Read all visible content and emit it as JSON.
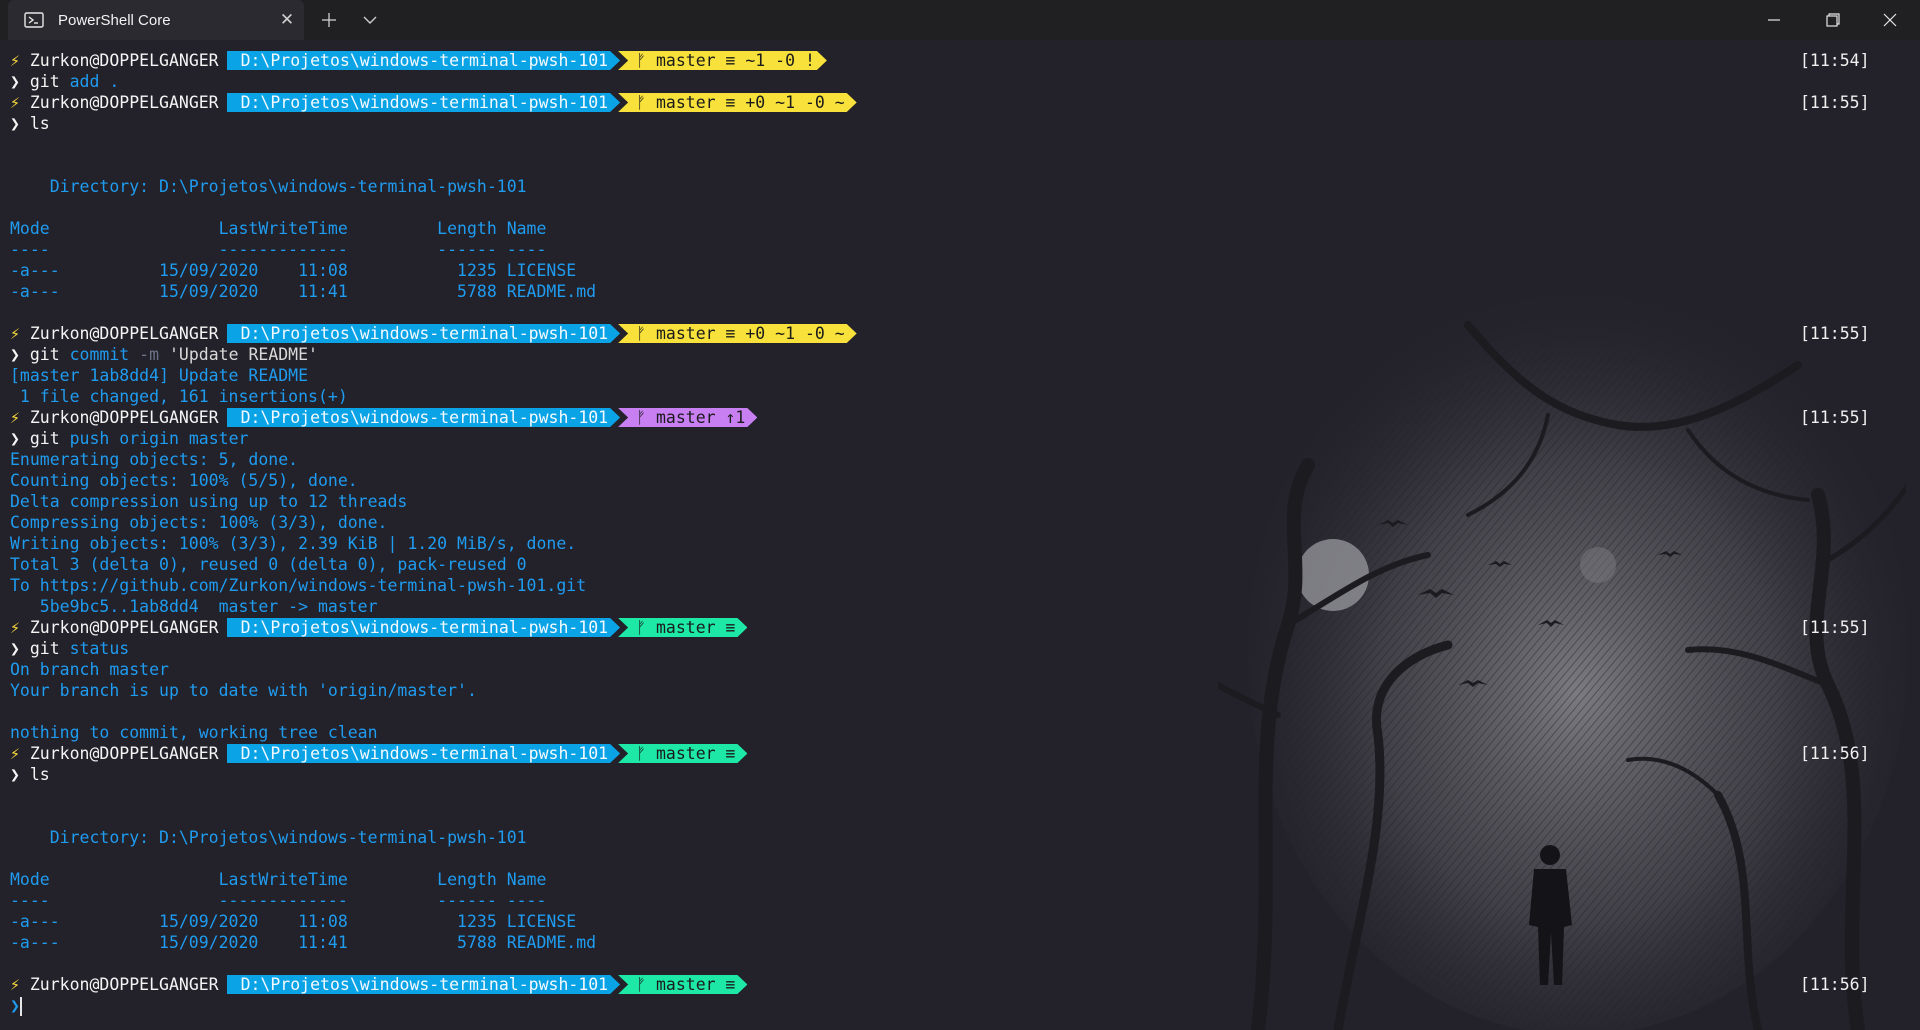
{
  "window": {
    "tab_title": "PowerShell Core",
    "tab_icon": "powershell-icon",
    "new_tab_icon": "plus-icon",
    "dropdown_icon": "chevron-down-icon",
    "minimize_icon": "minimize-icon",
    "maximize_icon": "restore-icon",
    "close_icon": "close-icon"
  },
  "colors": {
    "background": "#232129",
    "path_segment": "#0aa3e6",
    "git_dirty": "#f7e13a",
    "git_ahead": "#c77ff2",
    "git_clean": "#1ee8a6",
    "output": "#1f9cf0"
  },
  "prompt": {
    "symbol": "⚡",
    "user": "Zurkon@DOPPELGANGER",
    "path": "D:\\Projetos\\windows-terminal-pwsh-101",
    "branch_icon": "ᚠ",
    "input_symbol": "❯"
  },
  "lines": [
    {
      "kind": "prompt",
      "git": "master ≡ ~1 -0 !",
      "git_color": "#f7e13a",
      "time": "[11:54]"
    },
    {
      "kind": "cmd",
      "cmd": "git",
      "args": "add",
      "rest": " ."
    },
    {
      "kind": "prompt",
      "git": "master ≡ +0 ~1 -0 ~",
      "git_color": "#f7e13a",
      "time": "[11:55]"
    },
    {
      "kind": "cmd",
      "cmd": "ls",
      "args": "",
      "rest": ""
    },
    {
      "kind": "blank"
    },
    {
      "kind": "blank"
    },
    {
      "kind": "out",
      "text": "    Directory: D:\\Projetos\\windows-terminal-pwsh-101"
    },
    {
      "kind": "blank"
    },
    {
      "kind": "out",
      "text": "Mode                 LastWriteTime         Length Name"
    },
    {
      "kind": "out",
      "text": "----                 -------------         ------ ----"
    },
    {
      "kind": "out",
      "text": "-a---          15/09/2020    11:08           1235 LICENSE"
    },
    {
      "kind": "out",
      "text": "-a---          15/09/2020    11:41           5788 README.md"
    },
    {
      "kind": "blank"
    },
    {
      "kind": "prompt",
      "git": "master ≡ +0 ~1 -0 ~",
      "git_color": "#f7e13a",
      "time": "[11:55]"
    },
    {
      "kind": "cmdstr",
      "cmd": "git",
      "args": "commit",
      "flag": "-m",
      "str": "'Update README'"
    },
    {
      "kind": "out",
      "text": "[master 1ab8dd4] Update README"
    },
    {
      "kind": "out",
      "text": " 1 file changed, 161 insertions(+)"
    },
    {
      "kind": "prompt",
      "git": "master ↑1",
      "git_color": "#c77ff2",
      "time": "[11:55]"
    },
    {
      "kind": "cmd",
      "cmd": "git",
      "args": "push origin master",
      "rest": ""
    },
    {
      "kind": "out",
      "text": "Enumerating objects: 5, done."
    },
    {
      "kind": "out",
      "text": "Counting objects: 100% (5/5), done."
    },
    {
      "kind": "out",
      "text": "Delta compression using up to 12 threads"
    },
    {
      "kind": "out",
      "text": "Compressing objects: 100% (3/3), done."
    },
    {
      "kind": "out",
      "text": "Writing objects: 100% (3/3), 2.39 KiB | 1.20 MiB/s, done."
    },
    {
      "kind": "out",
      "text": "Total 3 (delta 0), reused 0 (delta 0), pack-reused 0"
    },
    {
      "kind": "out",
      "text": "To https://github.com/Zurkon/windows-terminal-pwsh-101.git"
    },
    {
      "kind": "out",
      "text": "   5be9bc5..1ab8dd4  master -> master"
    },
    {
      "kind": "prompt",
      "git": "master ≡",
      "git_color": "#1ee8a6",
      "time": "[11:55]"
    },
    {
      "kind": "cmd",
      "cmd": "git",
      "args": "status",
      "rest": ""
    },
    {
      "kind": "out",
      "text": "On branch master"
    },
    {
      "kind": "out",
      "text": "Your branch is up to date with 'origin/master'."
    },
    {
      "kind": "blank"
    },
    {
      "kind": "out",
      "text": "nothing to commit, working tree clean"
    },
    {
      "kind": "prompt",
      "git": "master ≡",
      "git_color": "#1ee8a6",
      "time": "[11:56]"
    },
    {
      "kind": "cmd",
      "cmd": "ls",
      "args": "",
      "rest": ""
    },
    {
      "kind": "blank"
    },
    {
      "kind": "blank"
    },
    {
      "kind": "out",
      "text": "    Directory: D:\\Projetos\\windows-terminal-pwsh-101"
    },
    {
      "kind": "blank"
    },
    {
      "kind": "out",
      "text": "Mode                 LastWriteTime         Length Name"
    },
    {
      "kind": "out",
      "text": "----                 -------------         ------ ----"
    },
    {
      "kind": "out",
      "text": "-a---          15/09/2020    11:08           1235 LICENSE"
    },
    {
      "kind": "out",
      "text": "-a---          15/09/2020    11:41           5788 README.md"
    },
    {
      "kind": "blank"
    },
    {
      "kind": "prompt",
      "git": "master ≡",
      "git_color": "#1ee8a6",
      "time": "[11:56]"
    },
    {
      "kind": "input"
    }
  ]
}
